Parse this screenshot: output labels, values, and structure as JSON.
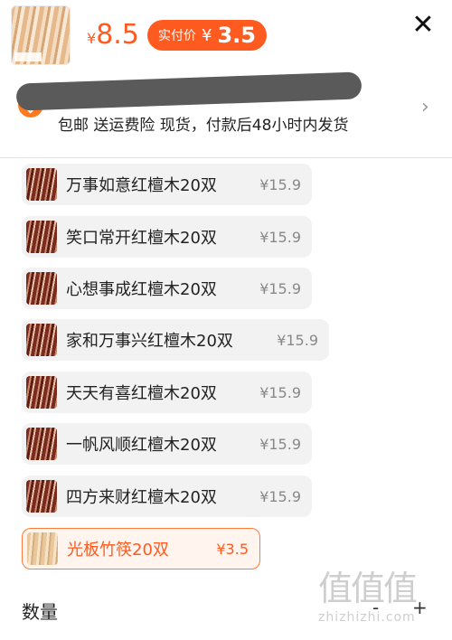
{
  "header": {
    "currency": "¥",
    "original_price": "8.5",
    "pay_label": "实付价",
    "pay_currency": "¥",
    "pay_price": "3.5",
    "close_icon": "close-icon"
  },
  "shipping": {
    "title": "",
    "line": "包邮  送运费险  现货，付款后48小时内发货",
    "arrow_icon": "chevron-right-icon"
  },
  "options": [
    {
      "name": "万事如意红檀木20双",
      "price": "¥15.9",
      "selected": false
    },
    {
      "name": "笑口常开红檀木20双",
      "price": "¥15.9",
      "selected": false
    },
    {
      "name": "心想事成红檀木20双",
      "price": "¥15.9",
      "selected": false
    },
    {
      "name": "家和万事兴红檀木20双",
      "price": "¥15.9",
      "selected": false
    },
    {
      "name": "天天有喜红檀木20双",
      "price": "¥15.9",
      "selected": false
    },
    {
      "name": "一帆风顺红檀木20双",
      "price": "¥15.9",
      "selected": false
    },
    {
      "name": "四方来财红檀木20双",
      "price": "¥15.9",
      "selected": false
    },
    {
      "name": "光板竹筷20双",
      "price": "¥3.5",
      "selected": true
    }
  ],
  "quantity": {
    "label": "数量",
    "minus": "-",
    "plus": "+"
  },
  "watermark": {
    "glyphs": "值值值",
    "text": "zhizhizhi.com"
  },
  "colors": {
    "accent": "#ff5a1f",
    "selected_border": "#ff7a3a",
    "option_bg": "#f2f2f2"
  }
}
